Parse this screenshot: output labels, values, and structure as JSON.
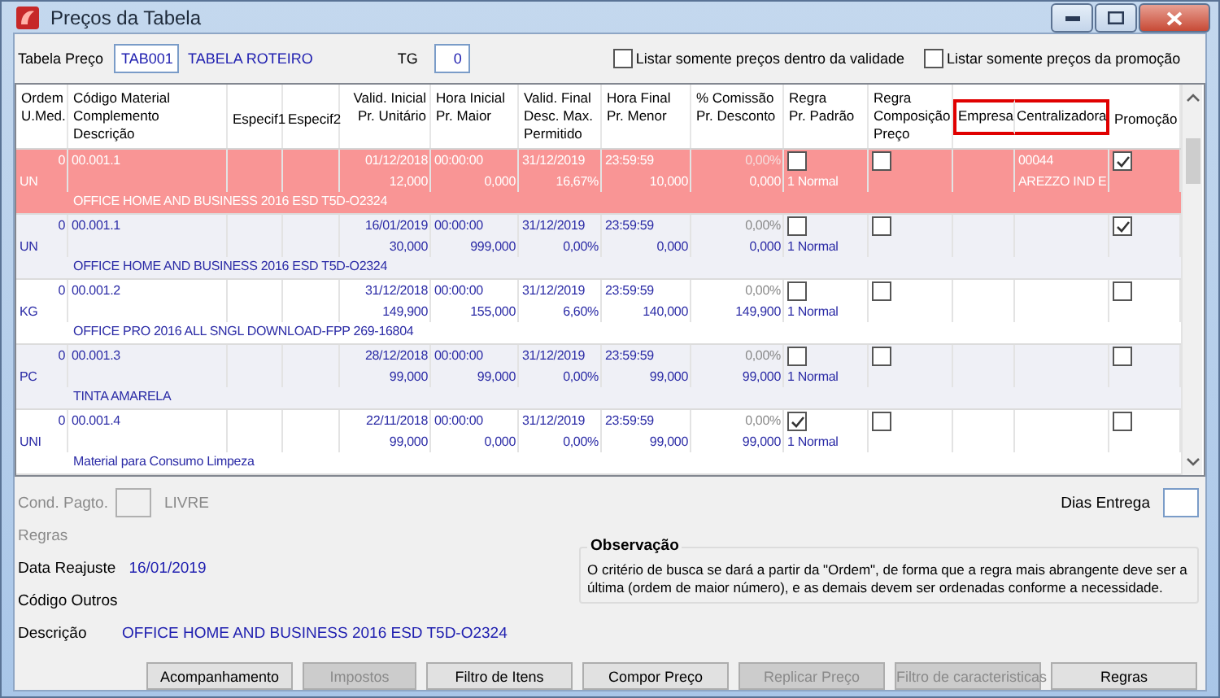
{
  "window": {
    "title": "Preços da Tabela"
  },
  "filters": {
    "tabela_label": "Tabela Preço",
    "tabela_value": "TAB001",
    "tabela_nome": "TABELA ROTEIRO",
    "tg_label": "TG",
    "tg_value": "0",
    "checkboxes": [
      {
        "label": "Listar somente preços dentro da validade",
        "checked": false
      },
      {
        "label": "Listar somente preços da promoção",
        "checked": false
      }
    ]
  },
  "table": {
    "columns": [
      {
        "lines": [
          "Ordem",
          "U.Med."
        ],
        "highlighted": false
      },
      {
        "lines": [
          "Código Material",
          "Complemento",
          "Descrição"
        ],
        "highlighted": false
      },
      {
        "lines": [
          "Especif1"
        ],
        "highlighted": false
      },
      {
        "lines": [
          "Especif2"
        ],
        "highlighted": false
      },
      {
        "lines": [
          "Valid. Inicial",
          "Pr. Unitário"
        ],
        "highlighted": false
      },
      {
        "lines": [
          "Hora Inicial",
          "Pr. Maior"
        ],
        "highlighted": false
      },
      {
        "lines": [
          "Valid. Final",
          "Desc. Max.",
          "Permitido"
        ],
        "highlighted": false
      },
      {
        "lines": [
          "Hora Final",
          "Pr. Menor"
        ],
        "highlighted": false
      },
      {
        "lines": [
          "% Comissão",
          "Pr. Desconto"
        ],
        "highlighted": false
      },
      {
        "lines": [
          "Regra",
          "Pr. Padrão"
        ],
        "highlighted": false
      },
      {
        "lines": [
          "Regra",
          "Composição",
          "Preço"
        ],
        "highlighted": false
      },
      {
        "lines": [
          "Empresa"
        ],
        "highlighted": true
      },
      {
        "lines": [
          "Centralizadora"
        ],
        "highlighted": true
      },
      {
        "lines": [
          "Promoção"
        ],
        "highlighted": false
      }
    ],
    "rows": [
      {
        "selected": true,
        "ordem": "0",
        "unidade": "UN",
        "codigo": "00.001.1",
        "valid_inicial": "01/12/2018",
        "pr_unitario": "12,000",
        "hora_inicial": "00:00:00",
        "pr_maior": "0,000",
        "valid_final": "31/12/2019",
        "desc_max": "16,67%",
        "hora_final": "23:59:59",
        "pr_menor": "10,000",
        "comissao": "0,00%",
        "pr_desconto": "0,000",
        "regra_padrao": false,
        "regra": "1 Normal",
        "composicao": false,
        "centralizadora_codigo": "00044",
        "centralizadora_nome": "AREZZO IND E",
        "promocao": true,
        "descricao": "OFFICE HOME AND BUSINESS 2016 ESD T5D-O2324"
      },
      {
        "selected": false,
        "ordem": "0",
        "unidade": "UN",
        "codigo": "00.001.1",
        "valid_inicial": "16/01/2019",
        "pr_unitario": "30,000",
        "hora_inicial": "00:00:00",
        "pr_maior": "999,000",
        "valid_final": "31/12/2019",
        "desc_max": "0,00%",
        "hora_final": "23:59:59",
        "pr_menor": "0,000",
        "comissao": "0,00%",
        "pr_desconto": "0,000",
        "regra_padrao": false,
        "regra": "1 Normal",
        "composicao": false,
        "promocao": true,
        "descricao": "OFFICE HOME AND BUSINESS 2016 ESD T5D-O2324"
      },
      {
        "selected": false,
        "ordem": "0",
        "unidade": "KG",
        "codigo": "00.001.2",
        "valid_inicial": "31/12/2018",
        "pr_unitario": "149,900",
        "hora_inicial": "00:00:00",
        "pr_maior": "155,000",
        "valid_final": "31/12/2019",
        "desc_max": "6,60%",
        "hora_final": "23:59:59",
        "pr_menor": "140,000",
        "comissao": "0,00%",
        "pr_desconto": "149,900",
        "regra_padrao": false,
        "regra": "1 Normal",
        "composicao": false,
        "promocao": false,
        "descricao": "OFFICE PRO 2016 ALL SNGL DOWNLOAD-FPP 269-16804"
      },
      {
        "selected": false,
        "ordem": "0",
        "unidade": "PC",
        "codigo": "00.001.3",
        "valid_inicial": "28/12/2018",
        "pr_unitario": "99,000",
        "hora_inicial": "00:00:00",
        "pr_maior": "99,000",
        "valid_final": "31/12/2019",
        "desc_max": "0,00%",
        "hora_final": "23:59:59",
        "pr_menor": "99,000",
        "comissao": "0,00%",
        "pr_desconto": "99,000",
        "regra_padrao": false,
        "regra": "1 Normal",
        "composicao": false,
        "promocao": false,
        "descricao": "TINTA AMARELA"
      },
      {
        "selected": false,
        "ordem": "0",
        "unidade": "UNI",
        "codigo": "00.001.4",
        "valid_inicial": "22/11/2018",
        "pr_unitario": "99,000",
        "hora_inicial": "00:00:00",
        "pr_maior": "0,000",
        "valid_final": "31/12/2019",
        "desc_max": "0,00%",
        "hora_final": "23:59:59",
        "pr_menor": "99,000",
        "comissao": "0,00%",
        "pr_desconto": "99,000",
        "regra_padrao": true,
        "regra": "1 Normal",
        "composicao": false,
        "promocao": false,
        "descricao": "Material para Consumo Limpeza"
      }
    ]
  },
  "details": {
    "cond_label": "Cond. Pagto.",
    "cond_disabled": true,
    "cond_text": "LIVRE",
    "dias_label": "Dias Entrega",
    "regras_label": "Regras",
    "data_label": "Data Reajuste",
    "data_value": "16/01/2019",
    "codigo_label": "Código Outros",
    "descricao_label": "Descrição",
    "descricao_value": "OFFICE HOME AND BUSINESS 2016 ESD T5D-O2324",
    "observacao": {
      "title": "Observação",
      "text": "O critério de busca se dará a partir da \"Ordem\", de forma que a regra mais abrangente deve ser a última (ordem de maior número), e as demais devem ser ordenadas conforme a necessidade."
    }
  },
  "buttons": [
    {
      "label": "Acompanhamento",
      "disabled": false
    },
    {
      "label": "Impostos",
      "disabled": true
    },
    {
      "label": "Filtro de Itens",
      "disabled": false
    },
    {
      "label": "Compor Preço",
      "disabled": false
    },
    {
      "label": "Replicar Preço",
      "disabled": true
    },
    {
      "label": "Filtro de caracteristicas",
      "disabled": true
    },
    {
      "label": "Regras",
      "disabled": false
    }
  ]
}
